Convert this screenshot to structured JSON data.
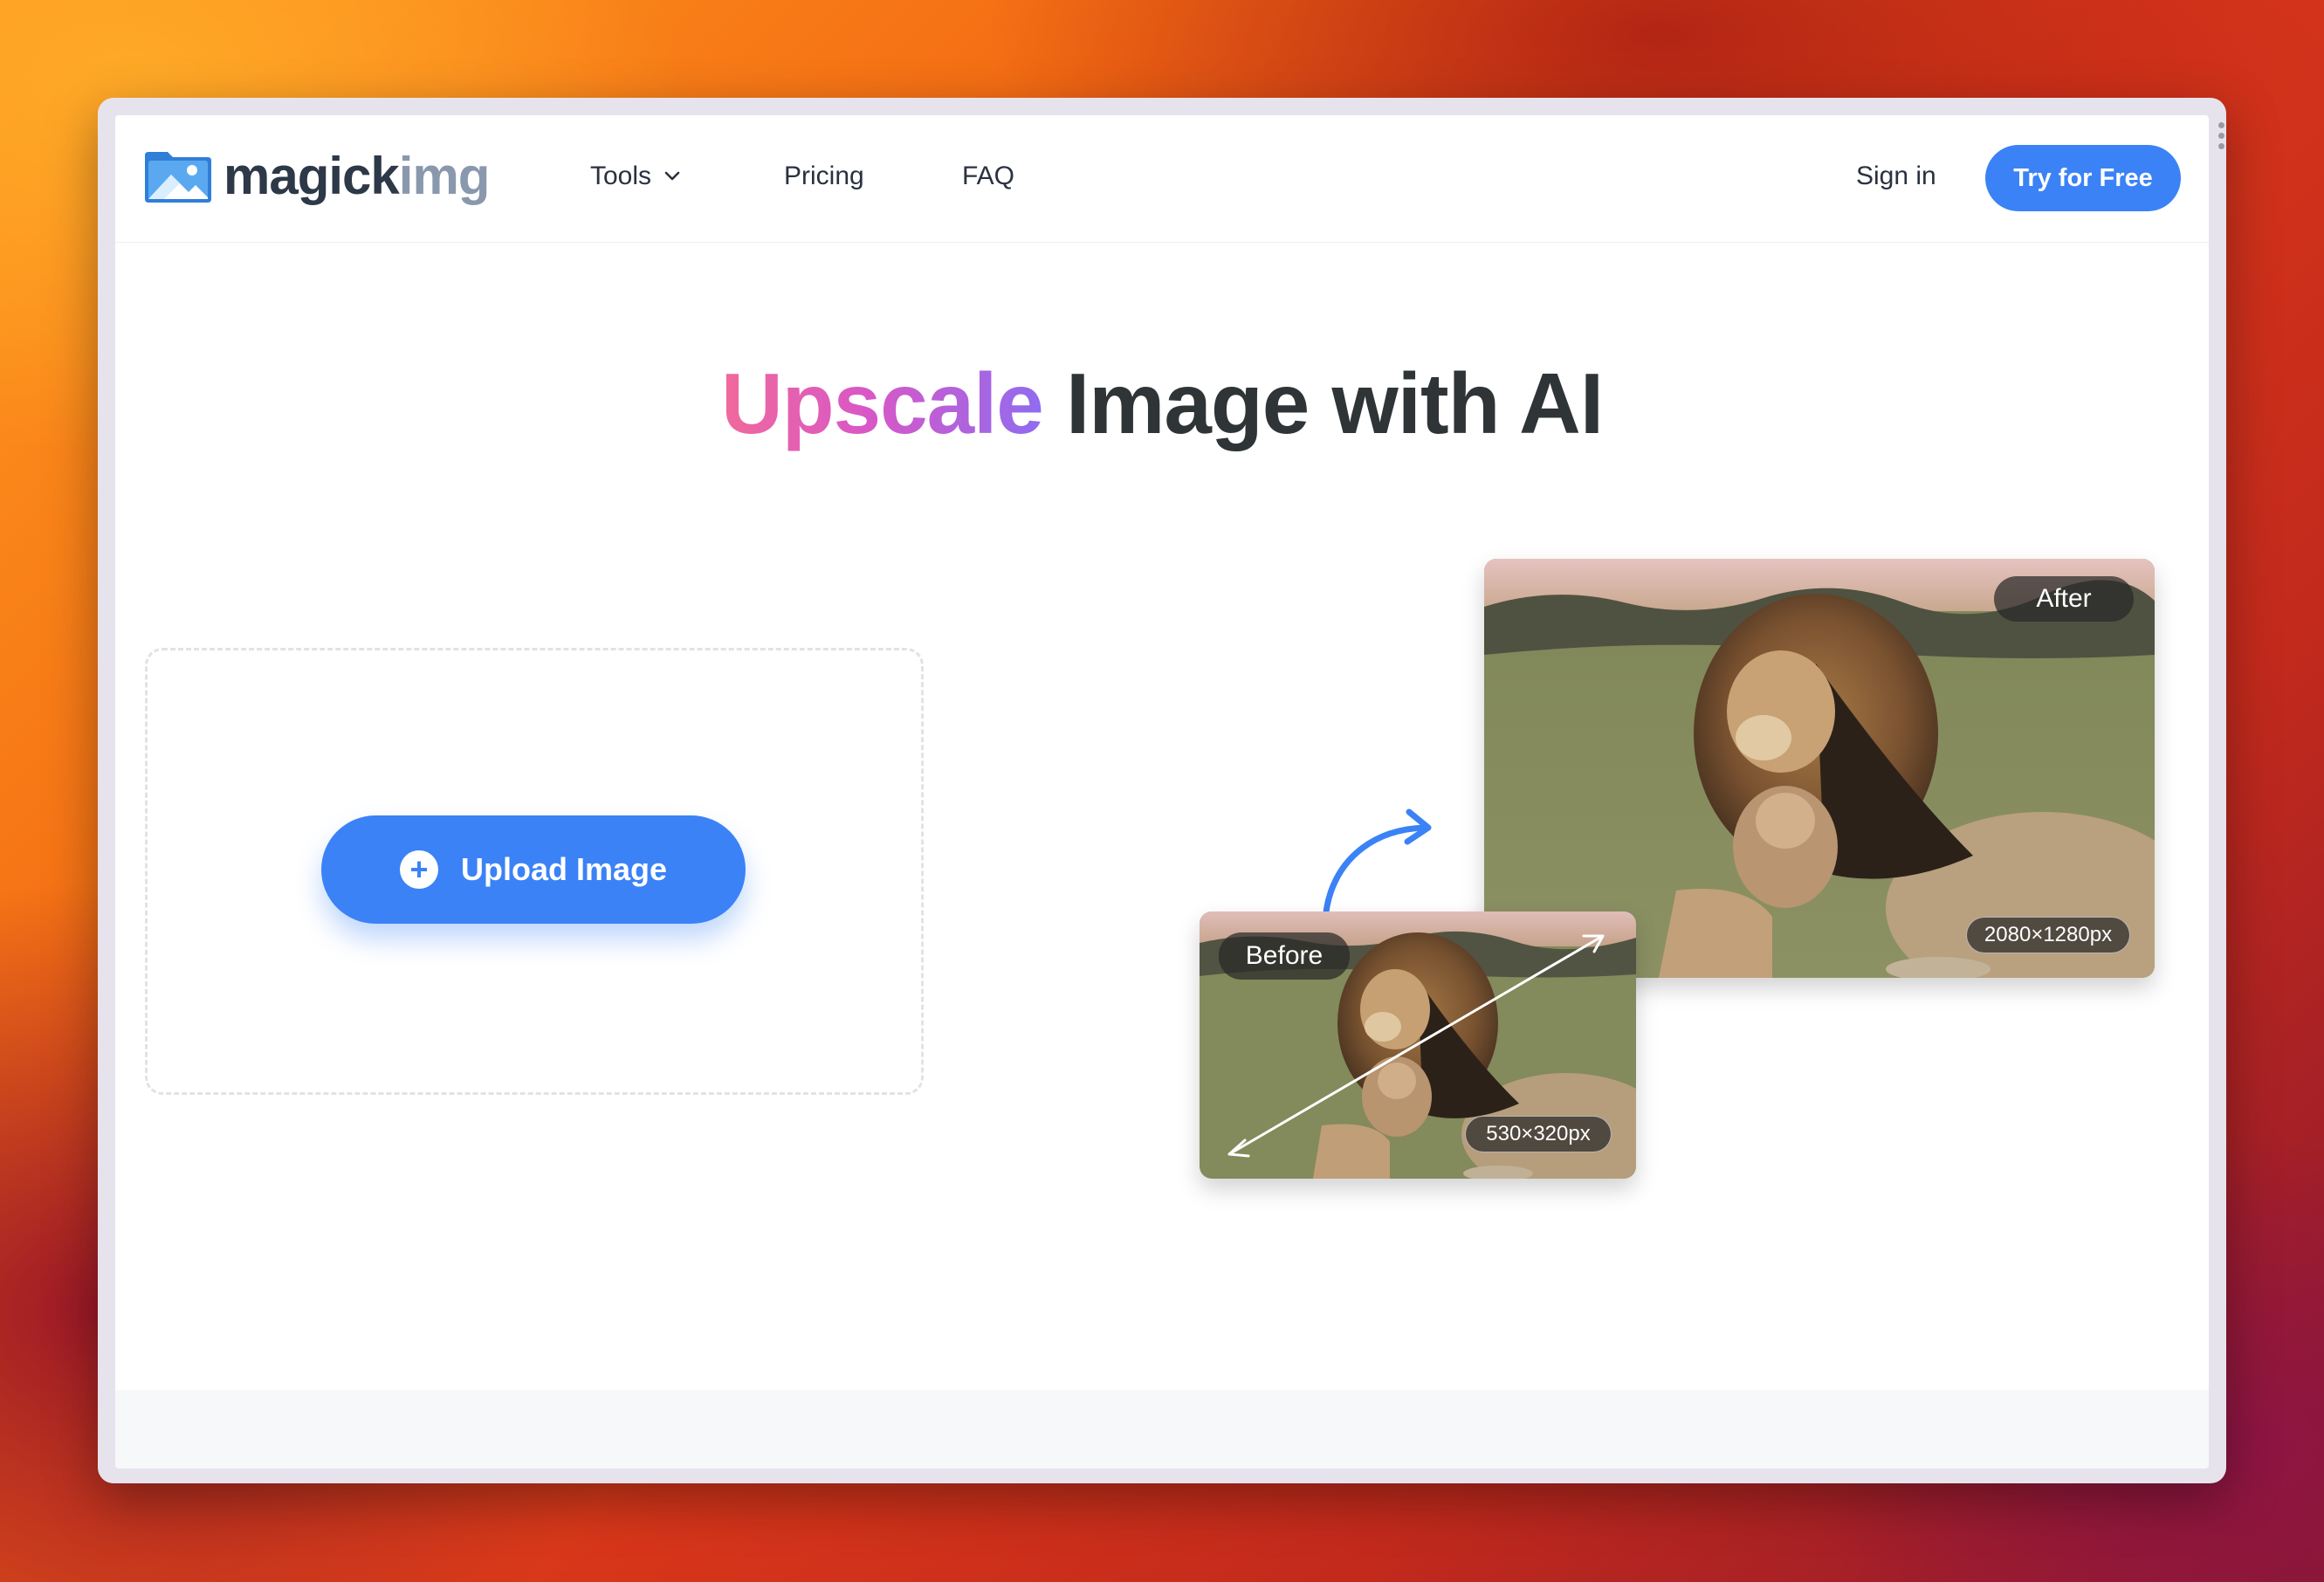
{
  "nav": {
    "logo": {
      "part1": "magick",
      "part2": "img"
    },
    "links": [
      {
        "label": "Tools",
        "has_dropdown": true
      },
      {
        "label": "Pricing"
      },
      {
        "label": "FAQ"
      }
    ],
    "sign_in": "Sign in",
    "cta": "Try for Free"
  },
  "hero": {
    "title_accent": "Upscale",
    "title_rest": " Image with AI"
  },
  "upload": {
    "button_label": "Upload Image",
    "icon": "plus-circle-icon"
  },
  "comparison": {
    "after": {
      "label": "After",
      "size": "2080×1280px"
    },
    "before": {
      "label": "Before",
      "size": "530×320px"
    }
  },
  "colors": {
    "primary": "#3b82f6",
    "title_gradient": [
      "#f06a9b",
      "#d957c6",
      "#8f6cf0"
    ],
    "text_dark": "#2f3437",
    "logo_dark": "#2d3848",
    "logo_light": "#8a98ad"
  }
}
